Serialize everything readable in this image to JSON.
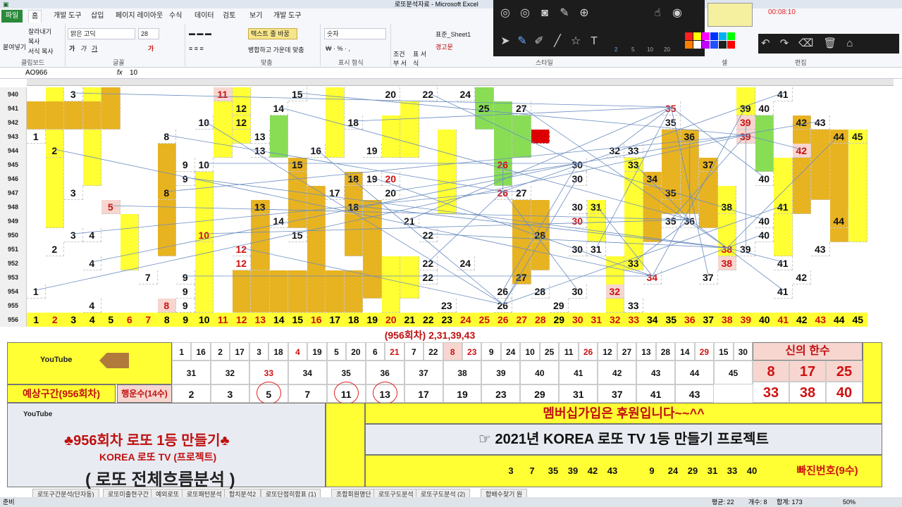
{
  "title_bar": {
    "title": "로또분석자료 - Microsoft Excel"
  },
  "ribbon": {
    "tabs": [
      "파일",
      "홈",
      "개발 도구",
      "삽입",
      "페이지 레이아웃",
      "수식",
      "데이터",
      "검토",
      "보기",
      "개발 도구"
    ],
    "clipboard": [
      "잘라내기",
      "복사",
      "서식 복사"
    ],
    "paste": "붙여넣기",
    "font_name": "맑은 고딕",
    "font_size": "28",
    "wrap_text": "텍스트 줄 바꿈",
    "merge": "병합하고 가운데 맞춤",
    "number_format": "숫자",
    "cond_format": "조건부 서식",
    "table_format": "표 서식",
    "style1": "표준_Sheet1",
    "style2": "경고문",
    "groups": [
      "클립보드",
      "글꼴",
      "맞춤",
      "표시 형식",
      "스타일",
      "셀",
      "편집"
    ]
  },
  "formula_bar": {
    "name_box": "AO966",
    "fx": "fx",
    "value": "10"
  },
  "toolbar": {
    "timer": "00:08:10",
    "sizes": [
      "2",
      "5",
      "10",
      "20"
    ],
    "colors": [
      "#ff2020",
      "#ffff00",
      "#ff00ff",
      "#0030ff",
      "#00b0f0",
      "#00ff00",
      "#ff8000",
      "#ffffff",
      "#c000ff",
      "#2050ff",
      "#202020",
      "#ff0000"
    ]
  },
  "sheet": {
    "rows": [
      "940",
      "941",
      "942",
      "943",
      "944",
      "945",
      "946",
      "947",
      "948",
      "949",
      "950",
      "951",
      "952",
      "953",
      "954",
      "955",
      "956"
    ],
    "numbers": [
      [
        {
          "c": 3,
          "v": "3"
        },
        {
          "c": 11,
          "v": "11",
          "s": "pink"
        },
        {
          "c": 15,
          "v": "15"
        },
        {
          "c": 20,
          "v": "20"
        },
        {
          "c": 22,
          "v": "22"
        },
        {
          "c": 24,
          "v": "24"
        },
        {
          "c": 41,
          "v": "41"
        }
      ],
      [
        {
          "c": 12,
          "v": "12"
        },
        {
          "c": 14,
          "v": "14"
        },
        {
          "c": 25,
          "v": "25"
        },
        {
          "c": 27,
          "v": "27"
        },
        {
          "c": 35,
          "v": "35",
          "s": "red"
        },
        {
          "c": 39,
          "v": "39"
        },
        {
          "c": 40,
          "v": "40"
        }
      ],
      [
        {
          "c": 10,
          "v": "10"
        },
        {
          "c": 12,
          "v": "12"
        },
        {
          "c": 18,
          "v": "18"
        },
        {
          "c": 35,
          "v": "35"
        },
        {
          "c": 39,
          "v": "39",
          "s": "pink"
        },
        {
          "c": 42,
          "v": "42"
        },
        {
          "c": 43,
          "v": "43"
        }
      ],
      [
        {
          "c": 1,
          "v": "1"
        },
        {
          "c": 8,
          "v": "8"
        },
        {
          "c": 13,
          "v": "13"
        },
        {
          "c": 36,
          "v": "36"
        },
        {
          "c": 39,
          "v": "39",
          "s": "pink"
        },
        {
          "c": 44,
          "v": "44"
        },
        {
          "c": 45,
          "v": "45"
        }
      ],
      [
        {
          "c": 2,
          "v": "2"
        },
        {
          "c": 13,
          "v": "13"
        },
        {
          "c": 16,
          "v": "16"
        },
        {
          "c": 19,
          "v": "19"
        },
        {
          "c": 32,
          "v": "32"
        },
        {
          "c": 33,
          "v": "33"
        },
        {
          "c": 42,
          "v": "42",
          "s": "pink"
        }
      ],
      [
        {
          "c": 9,
          "v": "9"
        },
        {
          "c": 10,
          "v": "10"
        },
        {
          "c": 15,
          "v": "15"
        },
        {
          "c": 26,
          "v": "26",
          "s": "red"
        },
        {
          "c": 30,
          "v": "30"
        },
        {
          "c": 33,
          "v": "33"
        },
        {
          "c": 37,
          "v": "37"
        }
      ],
      [
        {
          "c": 9,
          "v": "9"
        },
        {
          "c": 18,
          "v": "18"
        },
        {
          "c": 19,
          "v": "19"
        },
        {
          "c": 20,
          "v": "20",
          "s": "red"
        },
        {
          "c": 30,
          "v": "30"
        },
        {
          "c": 34,
          "v": "34"
        },
        {
          "c": 40,
          "v": "40"
        }
      ],
      [
        {
          "c": 3,
          "v": "3"
        },
        {
          "c": 8,
          "v": "8"
        },
        {
          "c": 17,
          "v": "17"
        },
        {
          "c": 20,
          "v": "20"
        },
        {
          "c": 26,
          "v": "26",
          "s": "red"
        },
        {
          "c": 27,
          "v": "27"
        },
        {
          "c": 35,
          "v": "35"
        }
      ],
      [
        {
          "c": 5,
          "v": "5",
          "s": "pink"
        },
        {
          "c": 13,
          "v": "13"
        },
        {
          "c": 18,
          "v": "18"
        },
        {
          "c": 30,
          "v": "30"
        },
        {
          "c": 31,
          "v": "31"
        },
        {
          "c": 38,
          "v": "38"
        },
        {
          "c": 41,
          "v": "41"
        }
      ],
      [
        {
          "c": 14,
          "v": "14"
        },
        {
          "c": 21,
          "v": "21"
        },
        {
          "c": 30,
          "v": "30",
          "s": "red"
        },
        {
          "c": 35,
          "v": "35"
        },
        {
          "c": 36,
          "v": "36"
        },
        {
          "c": 40,
          "v": "40"
        },
        {
          "c": 44,
          "v": "44"
        }
      ],
      [
        {
          "c": 3,
          "v": "3"
        },
        {
          "c": 4,
          "v": "4"
        },
        {
          "c": 10,
          "v": "10",
          "s": "red"
        },
        {
          "c": 15,
          "v": "15"
        },
        {
          "c": 22,
          "v": "22"
        },
        {
          "c": 28,
          "v": "28"
        },
        {
          "c": 40,
          "v": "40"
        }
      ],
      [
        {
          "c": 2,
          "v": "2"
        },
        {
          "c": 12,
          "v": "12",
          "s": "red"
        },
        {
          "c": 30,
          "v": "30"
        },
        {
          "c": 31,
          "v": "31"
        },
        {
          "c": 38,
          "v": "38",
          "s": "red"
        },
        {
          "c": 39,
          "v": "39"
        },
        {
          "c": 43,
          "v": "43"
        }
      ],
      [
        {
          "c": 4,
          "v": "4"
        },
        {
          "c": 12,
          "v": "12",
          "s": "red"
        },
        {
          "c": 22,
          "v": "22"
        },
        {
          "c": 24,
          "v": "24"
        },
        {
          "c": 33,
          "v": "33"
        },
        {
          "c": 38,
          "v": "38",
          "s": "pink"
        },
        {
          "c": 41,
          "v": "41"
        }
      ],
      [
        {
          "c": 7,
          "v": "7"
        },
        {
          "c": 9,
          "v": "9"
        },
        {
          "c": 22,
          "v": "22"
        },
        {
          "c": 27,
          "v": "27"
        },
        {
          "c": 34,
          "v": "34",
          "s": "red"
        },
        {
          "c": 37,
          "v": "37"
        },
        {
          "c": 42,
          "v": "42"
        }
      ],
      [
        {
          "c": 1,
          "v": "1"
        },
        {
          "c": 9,
          "v": "9"
        },
        {
          "c": 26,
          "v": "26"
        },
        {
          "c": 28,
          "v": "28"
        },
        {
          "c": 30,
          "v": "30"
        },
        {
          "c": 32,
          "v": "32",
          "s": "pink"
        },
        {
          "c": 41,
          "v": "41"
        }
      ],
      [
        {
          "c": 4,
          "v": "4"
        },
        {
          "c": 8,
          "v": "8",
          "s": "pink"
        },
        {
          "c": 9,
          "v": "9"
        },
        {
          "c": 23,
          "v": "23"
        },
        {
          "c": 26,
          "v": "26"
        },
        {
          "c": 29,
          "v": "29"
        },
        {
          "c": 33,
          "v": "33"
        }
      ]
    ],
    "row956": [
      "1",
      "2",
      "3",
      "4",
      "5",
      "6",
      "7",
      "8",
      "9",
      "10",
      "11",
      "12",
      "13",
      "14",
      "15",
      "16",
      "17",
      "18",
      "19",
      "20",
      "21",
      "22",
      "23",
      "24",
      "25",
      "26",
      "27",
      "28",
      "29",
      "30",
      "31",
      "32",
      "33",
      "34",
      "35",
      "36",
      "37",
      "38",
      "39",
      "40",
      "41",
      "42",
      "43",
      "44",
      "45"
    ],
    "row956_red": [
      2,
      6,
      7,
      11,
      12,
      13,
      16,
      20,
      24,
      25,
      26,
      27,
      28,
      30,
      31,
      32,
      33,
      36,
      38,
      39,
      41,
      43
    ],
    "result": "(956회차) 2,31,39,43",
    "pairs_top": [
      "1",
      "16",
      "2",
      "17",
      "3",
      "18",
      "4",
      "19",
      "5",
      "20",
      "6",
      "21",
      "7",
      "22",
      "8",
      "23",
      "9",
      "24",
      "10",
      "25",
      "11",
      "26",
      "12",
      "27",
      "13",
      "28",
      "14",
      "29",
      "15",
      "30"
    ],
    "pairs_top_red": [
      "4",
      "21",
      "8",
      "23",
      "26",
      "29"
    ],
    "pairs_bottom": [
      "31",
      "32",
      "33",
      "34",
      "35",
      "36",
      "37",
      "38",
      "39",
      "40",
      "41",
      "42",
      "43",
      "44",
      "45"
    ],
    "god_title": "신의 한수",
    "god_nums": [
      "8",
      "17",
      "25",
      "33",
      "38",
      "40"
    ],
    "predict_label": "예상구간(956회차)",
    "lucky_label": "행운수(14수)",
    "lucky_nums": [
      "2",
      "3",
      "5",
      "7",
      "11",
      "13",
      "17",
      "19",
      "23",
      "29",
      "31",
      "37",
      "41",
      "43"
    ],
    "member_text": "멤버십가입은 후원입니다~~^^",
    "project_text": "☞ 2021년 KOREA 로또 TV 1등 만들기 프로젝트",
    "excluded_nums": [
      "3",
      "7",
      "35",
      "39",
      "42",
      "43",
      "9",
      "24",
      "29",
      "31",
      "33",
      "40"
    ],
    "excluded_label": "빠진번호(9수)",
    "promo_line1": "♣956회차 로또 1등 만들기♣",
    "promo_line2": "KOREA 로또 TV (프로젝트)",
    "promo_line3": "( 로또 전체흐름분석 )",
    "youtube": "YouTube"
  },
  "sheet_tabs": [
    "로또구간분석(단자동)",
    "로또미출현구간",
    "예외로또",
    "로또패턴분석",
    "합치분석2",
    "로또단점히함표 (1)",
    "조합회원명단",
    "로또구도분석",
    "로또구도분석 (2)",
    "합배수찾기 원"
  ],
  "status": {
    "mode": "준비",
    "avg": "평균: 22",
    "count": "개수: 8",
    "sum": "합계: 173",
    "zoom": "50%"
  }
}
